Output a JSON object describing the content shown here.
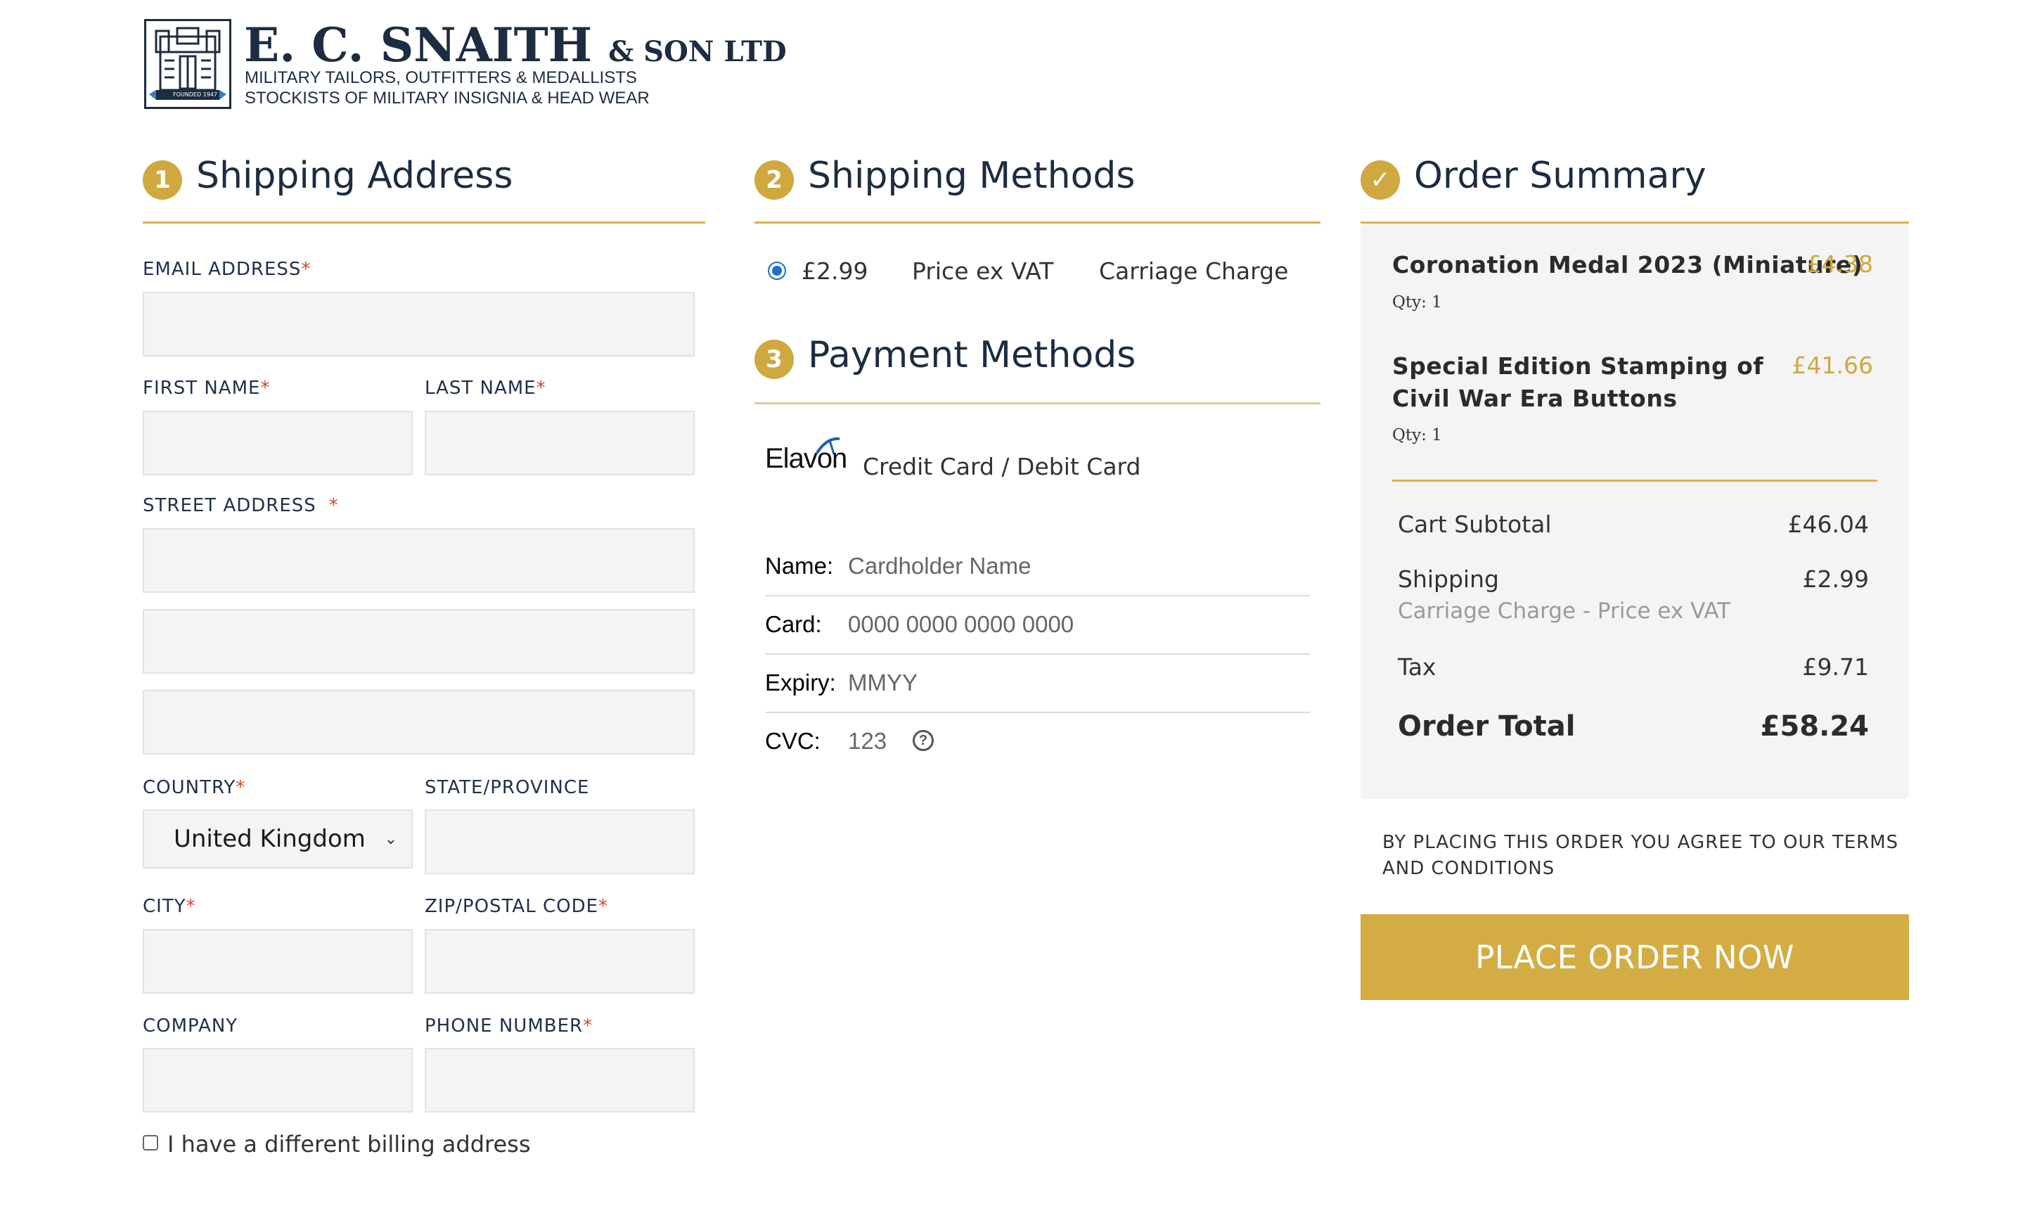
{
  "brand": {
    "name": "E. C. SNAITH",
    "suffix": "& SON LTD",
    "tagline1": "MILITARY TAILORS, OUTFITTERS & MEDALLISTS",
    "tagline2": "STOCKISTS OF MILITARY INSIGNIA & HEAD WEAR",
    "logo_banner": "FOUNDED 1947"
  },
  "shipping_address": {
    "step": "1",
    "title": "Shipping Address",
    "email_label": "EMAIL ADDRESS",
    "first_name_label": "FIRST NAME",
    "last_name_label": "LAST NAME",
    "street_label": "STREET ADDRESS",
    "country_label": "COUNTRY",
    "country_value": "United Kingdom",
    "state_label": "STATE/PROVINCE",
    "city_label": "CITY",
    "zip_label": "ZIP/POSTAL CODE",
    "company_label": "COMPANY",
    "phone_label": "PHONE NUMBER",
    "required_mark": "*",
    "billing_checkbox_label": "I have a different billing address"
  },
  "shipping_methods": {
    "step": "2",
    "title": "Shipping Methods",
    "option": {
      "price": "£2.99",
      "price_note": "Price ex VAT",
      "name": "Carriage Charge",
      "selected": true
    }
  },
  "payment_methods": {
    "step": "3",
    "title": "Payment Methods",
    "provider": "Elavon",
    "method_label": "Credit Card / Debit Card",
    "fields": {
      "name_label": "Name:",
      "name_placeholder": "Cardholder Name",
      "card_label": "Card:",
      "card_placeholder": "0000 0000 0000 0000",
      "expiry_label": "Expiry:",
      "expiry_placeholder": "MMYY",
      "cvc_label": "CVC:",
      "cvc_placeholder": "123",
      "help_glyph": "?"
    }
  },
  "order_summary": {
    "step_icon": "check-icon",
    "step_glyph": "✓",
    "title": "Order Summary",
    "items": [
      {
        "name": "Coronation Medal 2023 (Miniature)",
        "price": "£4.38",
        "qty": "Qty: 1"
      },
      {
        "name": "Special Edition Stamping of Civil War Era Buttons",
        "price": "£41.66",
        "qty": "Qty: 1"
      }
    ],
    "subtotal_label": "Cart Subtotal",
    "subtotal_value": "£46.04",
    "shipping_label": "Shipping",
    "shipping_value": "£2.99",
    "shipping_detail": "Carriage Charge - Price ex VAT",
    "tax_label": "Tax",
    "tax_value": "£9.71",
    "total_label": "Order Total",
    "total_value": "£58.24",
    "terms": "BY PLACING THIS ORDER YOU AGREE TO OUR TERMS AND CONDITIONS",
    "place_order_label": "PLACE ORDER NOW"
  },
  "colors": {
    "accent_gold": "#cfa840",
    "navy": "#1d2c40",
    "required_red": "#d4452b",
    "radio_blue": "#1b6fd0"
  }
}
